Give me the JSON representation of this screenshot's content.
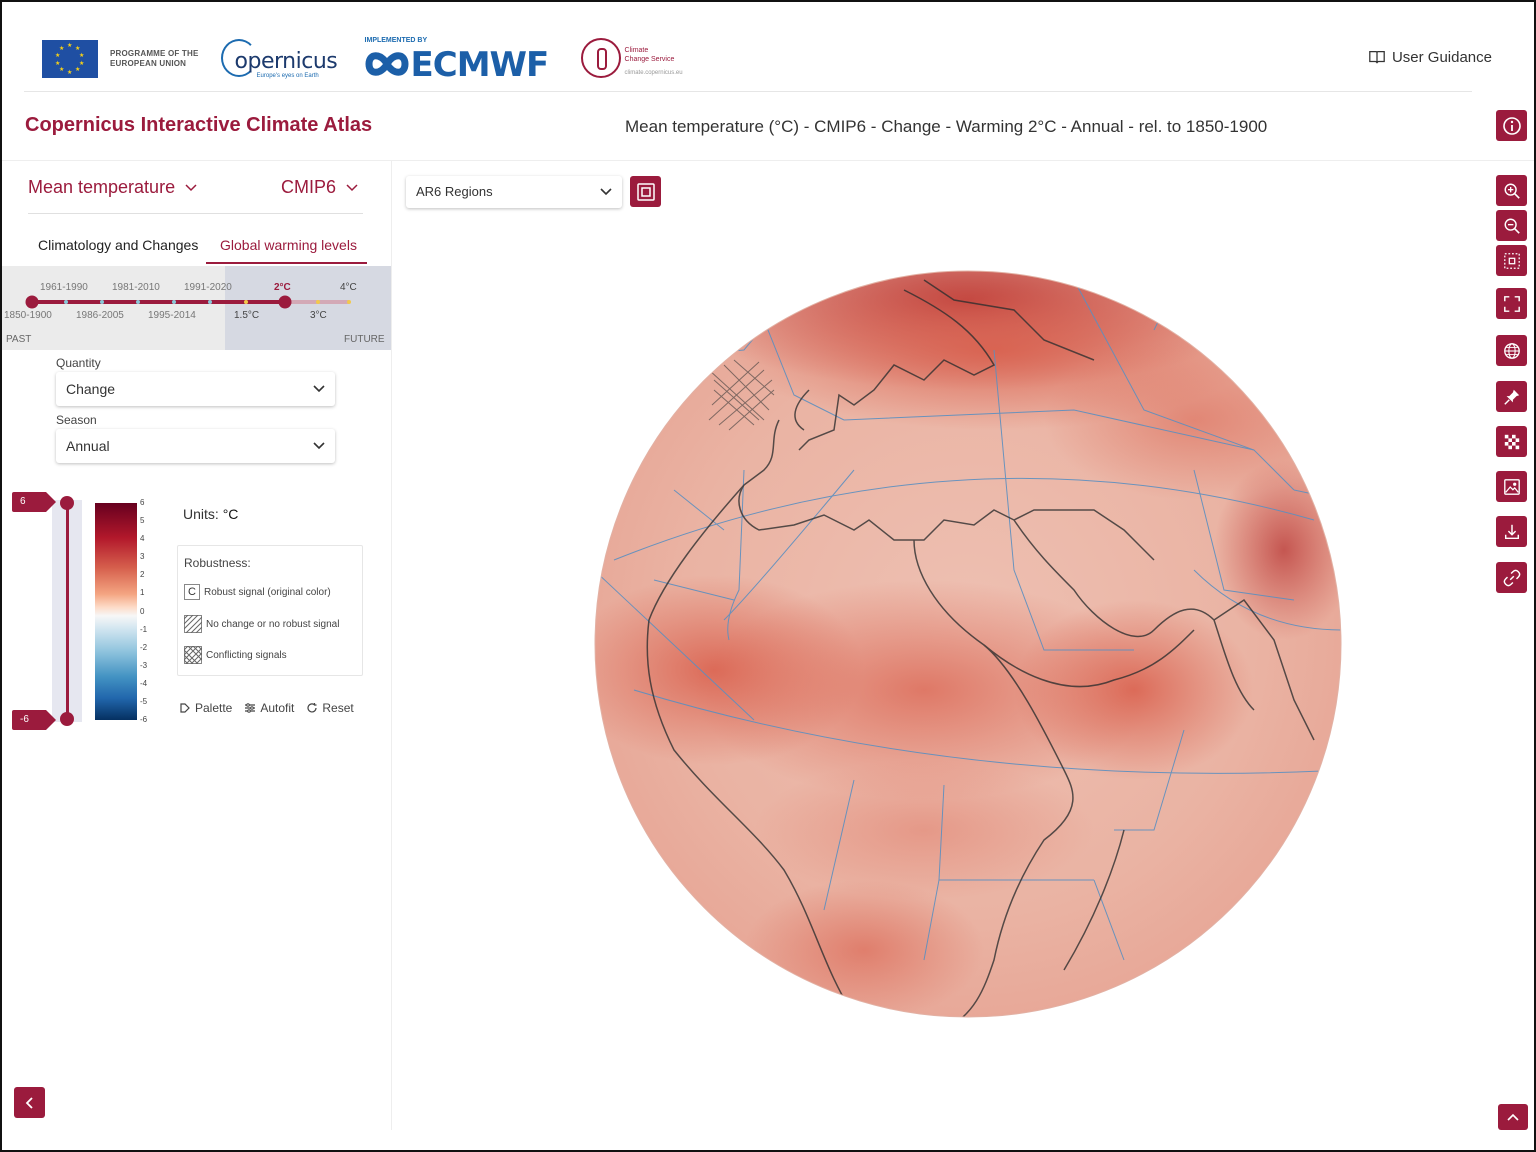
{
  "header": {
    "eu_text_line1": "PROGRAMME OF THE",
    "eu_text_line2": "EUROPEAN UNION",
    "copernicus_word": "opernicus",
    "copernicus_tagline": "Europe's eyes on Earth",
    "ecmwf_implemented": "IMPLEMENTED BY",
    "ecmwf_word": "ECMWF",
    "c3s_line1": "Climate",
    "c3s_line2": "Change Service",
    "c3s_url": "climate.copernicus.eu",
    "user_guidance": "User Guidance"
  },
  "app_title": "Copernicus Interactive Climate Atlas",
  "map_title": "Mean temperature (°C) - CMIP6 - Change - Warming 2°C - Annual - rel. to 1850-1900",
  "sidebar": {
    "variable": "Mean temperature",
    "dataset": "CMIP6",
    "tabs": [
      "Climatology and Changes",
      "Global warming levels"
    ],
    "timeline": {
      "upper_labels": [
        "1961-1990",
        "1981-2010",
        "1991-2020",
        "2°C",
        "4°C"
      ],
      "lower_labels": [
        "1850-1900",
        "1986-2005",
        "1995-2014",
        "1.5°C",
        "3°C"
      ],
      "past": "PAST",
      "future": "FUTURE",
      "selected": "2°C"
    },
    "quantity_label": "Quantity",
    "quantity_value": "Change",
    "season_label": "Season",
    "season_value": "Annual"
  },
  "legend": {
    "max_flag": "6",
    "min_flag": "-6",
    "ticks": [
      "6",
      "5",
      "4",
      "3",
      "2",
      "1",
      "0",
      "-1",
      "-2",
      "-3",
      "-4",
      "-5",
      "-6"
    ],
    "units_label": "Units:",
    "units_value": "°C",
    "robustness_title": "Robustness:",
    "robustness_items": [
      "Robust signal (original color)",
      "No change or no robust signal",
      "Conflicting signals"
    ],
    "robust_symbol": "C",
    "actions": [
      "Palette",
      "Autofit",
      "Reset"
    ]
  },
  "map": {
    "regions_select": "AR6 Regions"
  },
  "toolbar_icons": [
    "zoom-in-icon",
    "zoom-out-icon",
    "zoom-extent-icon",
    "fullscreen-icon",
    "globe-icon",
    "pin-icon",
    "robustness-pattern-icon",
    "image-icon",
    "download-icon",
    "link-icon"
  ],
  "colors": {
    "accent": "#9b1b3d",
    "globe_base": "#eaa797",
    "globe_hot": "#d8604f"
  }
}
